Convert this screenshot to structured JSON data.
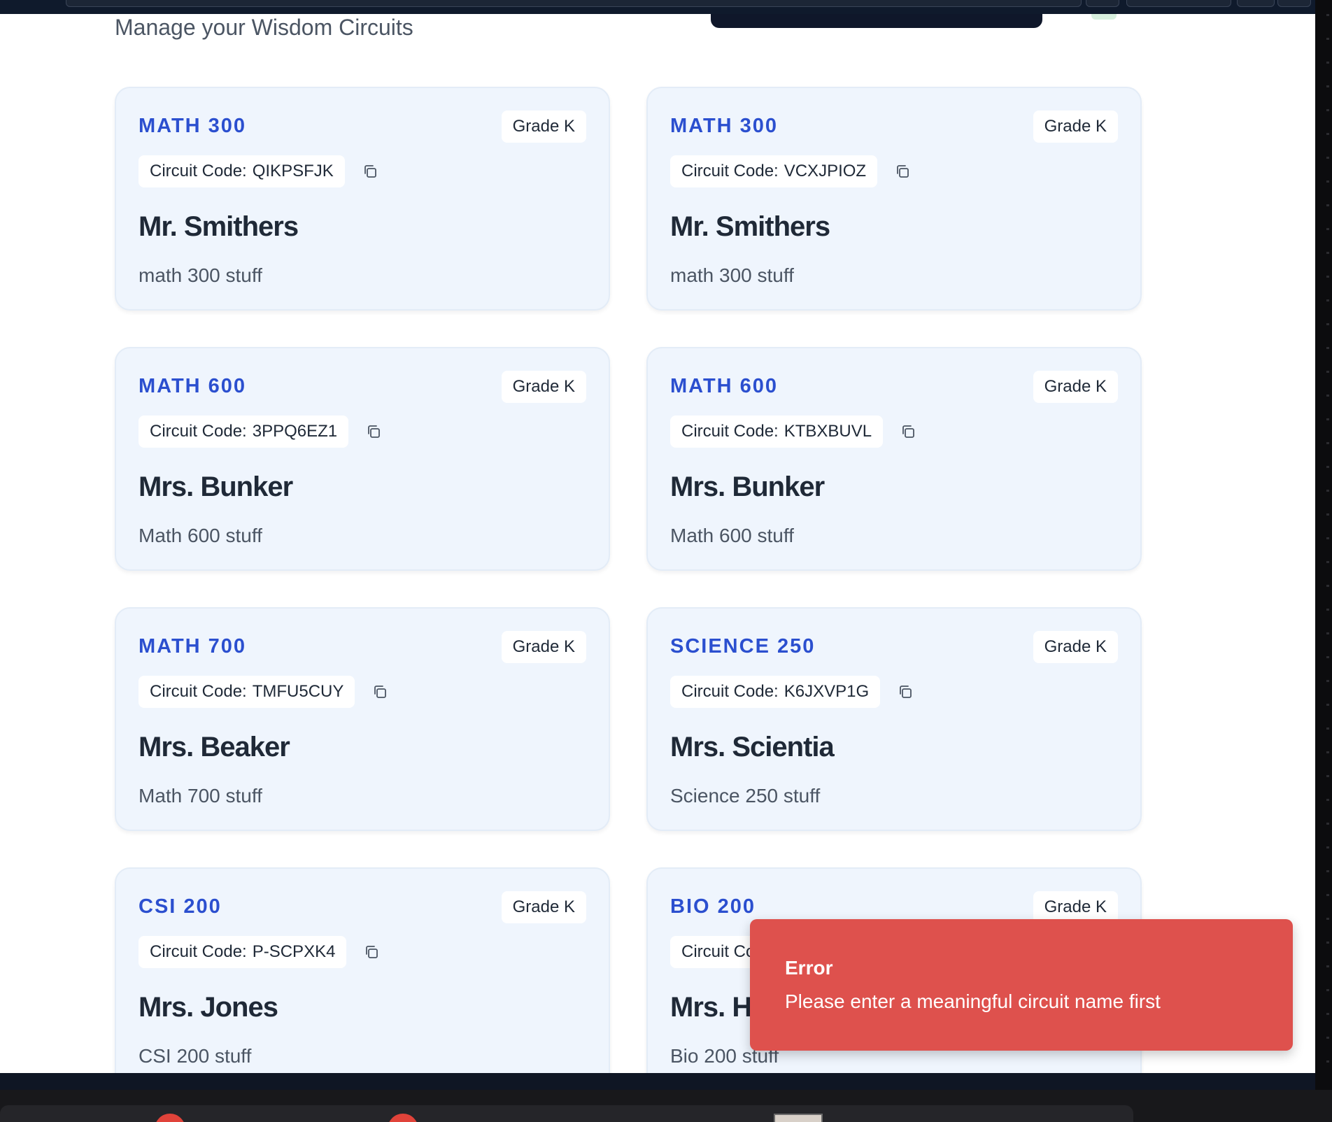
{
  "header": {
    "subtitle": "Manage your Wisdom Circuits"
  },
  "code_label": "Circuit Code:",
  "circuits": [
    {
      "name": "MATH 300",
      "grade": "Grade K",
      "code": "QIKPSFJK",
      "teacher": "Mr. Smithers",
      "description": "math 300 stuff"
    },
    {
      "name": "MATH 300",
      "grade": "Grade K",
      "code": "VCXJPIOZ",
      "teacher": "Mr. Smithers",
      "description": "math 300 stuff"
    },
    {
      "name": "MATH 600",
      "grade": "Grade K",
      "code": "3PPQ6EZ1",
      "teacher": "Mrs. Bunker",
      "description": "Math 600 stuff"
    },
    {
      "name": "MATH 600",
      "grade": "Grade K",
      "code": "KTBXBUVL",
      "teacher": "Mrs. Bunker",
      "description": "Math 600 stuff"
    },
    {
      "name": "MATH 700",
      "grade": "Grade K",
      "code": "TMFU5CUY",
      "teacher": "Mrs. Beaker",
      "description": "Math 700 stuff"
    },
    {
      "name": "SCIENCE 250",
      "grade": "Grade K",
      "code": "K6JXVP1G",
      "teacher": "Mrs. Scientia",
      "description": "Science 250 stuff"
    },
    {
      "name": "CSI 200",
      "grade": "Grade K",
      "code": "P-SCPXK4",
      "teacher": "Mrs. Jones",
      "description": "CSI 200 stuff"
    },
    {
      "name": "BIO 200",
      "grade": "Grade K",
      "code": "",
      "teacher": "Mrs. H",
      "description": "Bio 200 stuff"
    }
  ],
  "toast": {
    "title": "Error",
    "message": "Please enter a meaningful circuit name first"
  },
  "colors": {
    "accent": "#2b4fcf",
    "card_bg": "#eff5fd",
    "toast_bg": "#de514d"
  }
}
